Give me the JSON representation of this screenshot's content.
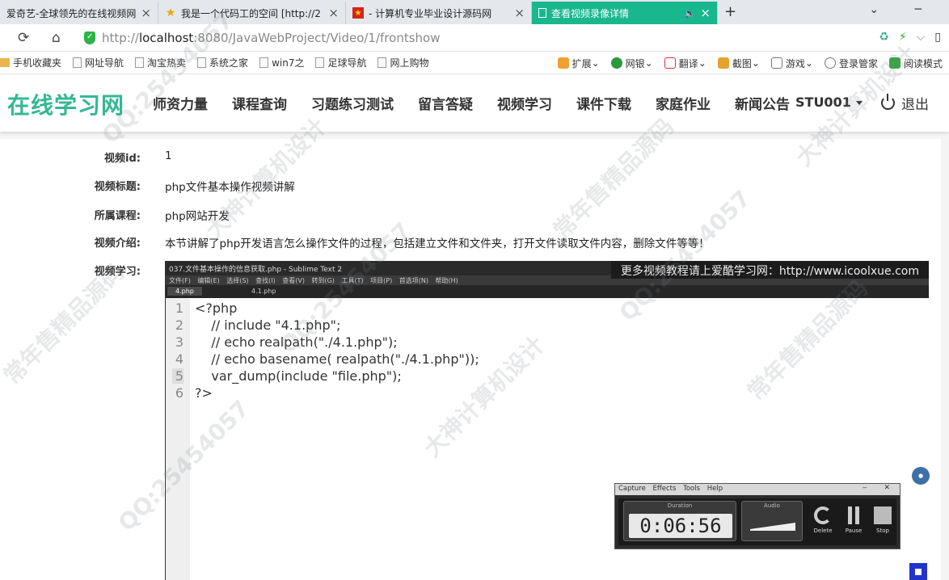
{
  "browser": {
    "tabs": [
      {
        "title": "爱奇艺-全球领先的在线视频网站",
        "active": false
      },
      {
        "title": "我是一个代码工的空间 [http://2",
        "active": false
      },
      {
        "title": "- 计算机专业毕业设计源码网",
        "active": false
      },
      {
        "title": "查看视频录像详情",
        "active": true
      }
    ],
    "address": {
      "scheme": "http://",
      "host": "localhost",
      "rest": ":8080/JavaWebProject/Video/1/frontshow"
    },
    "bookmarks": [
      "手机收藏夹",
      "网址导航",
      "淘宝热卖",
      "系统之家",
      "win7之",
      "足球导航",
      "网上购物"
    ],
    "tools": [
      "扩展",
      "网银",
      "翻译",
      "截图",
      "游戏",
      "登录管家",
      "阅读模式"
    ]
  },
  "site": {
    "logo": "在线学习网",
    "nav": [
      "师资力量",
      "课程查询",
      "习题练习测试",
      "留言答疑",
      "视频学习",
      "课件下载",
      "家庭作业",
      "新闻公告"
    ],
    "user": "STU001",
    "logout": "退出"
  },
  "details": [
    {
      "label": "视频id:",
      "value": "1"
    },
    {
      "label": "视频标题:",
      "value": "php文件基本操作视频讲解"
    },
    {
      "label": "所属课程:",
      "value": "php网站开发"
    },
    {
      "label": "视频介绍:",
      "value": "本节讲解了php开发语言怎么操作文件的过程，包括建立文件和文件夹，打开文件读取文件内容，删除文件等等！"
    }
  ],
  "video_label": "视频学习:",
  "video": {
    "window_title": "037.文件基本操作的信息获取.php - Sublime Text 2",
    "menu": "文件(F) 编辑(E) 选择(S) 查找(I) 查看(V) 转到(G) 工具(T) 项目(P) 首选项(N) 帮助(H)",
    "tabs": [
      "4.php",
      "4.1.php"
    ],
    "banner": "更多视频教程请上爱酷学习网：http://www.icoolxue.com",
    "code_lines": [
      "<?php",
      "    // include \"4.1.php\";",
      "    // echo realpath(\"./4.1.php\");",
      "    // echo basename( realpath(\"./4.1.php\"));",
      "    var_dump(include \"file.php\");",
      "?>"
    ]
  },
  "capture": {
    "menu": [
      "Capture",
      "Effects",
      "Tools",
      "Help"
    ],
    "duration_label": "Duration",
    "duration": "0:06:56",
    "audio_label": "Audio",
    "buttons": [
      "Delete",
      "Pause",
      "Stop"
    ]
  },
  "watermark": [
    "QQ:25454057",
    "大神计算机设计",
    "常年售精品源码"
  ],
  "colors": {
    "accent": "#33b894",
    "active_tab": "#19b78d"
  }
}
